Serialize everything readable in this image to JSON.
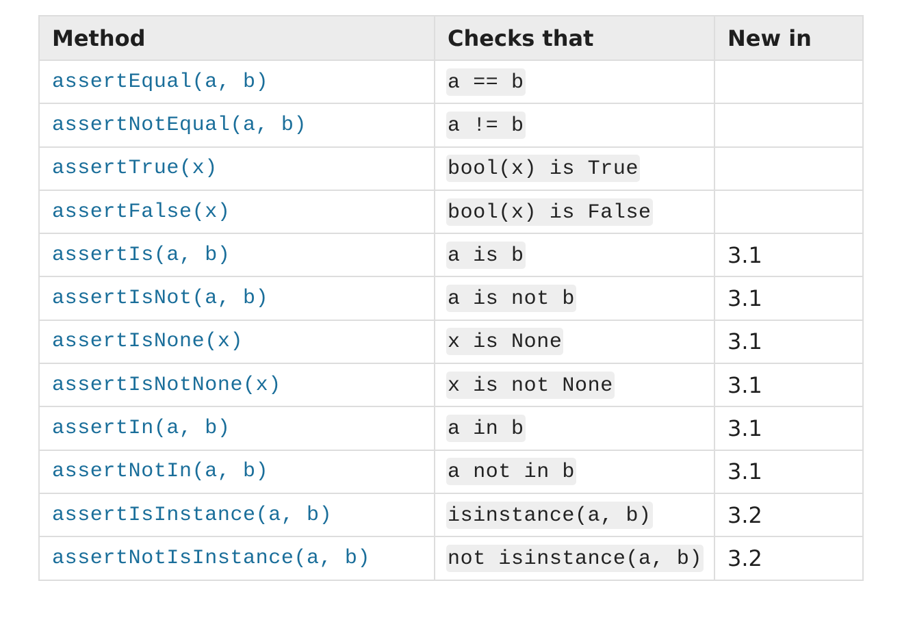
{
  "headers": {
    "method": "Method",
    "checks": "Checks that",
    "new_in": "New in"
  },
  "rows": [
    {
      "method": "assertEqual(a, b)",
      "checks": "a == b",
      "new_in": ""
    },
    {
      "method": "assertNotEqual(a, b)",
      "checks": "a != b",
      "new_in": ""
    },
    {
      "method": "assertTrue(x)",
      "checks": "bool(x) is True",
      "new_in": ""
    },
    {
      "method": "assertFalse(x)",
      "checks": "bool(x) is False",
      "new_in": ""
    },
    {
      "method": "assertIs(a, b)",
      "checks": "a is b",
      "new_in": "3.1"
    },
    {
      "method": "assertIsNot(a, b)",
      "checks": "a is not b",
      "new_in": "3.1"
    },
    {
      "method": "assertIsNone(x)",
      "checks": "x is None",
      "new_in": "3.1"
    },
    {
      "method": "assertIsNotNone(x)",
      "checks": "x is not None",
      "new_in": "3.1"
    },
    {
      "method": "assertIn(a, b)",
      "checks": "a in b",
      "new_in": "3.1"
    },
    {
      "method": "assertNotIn(a, b)",
      "checks": "a not in b",
      "new_in": "3.1"
    },
    {
      "method": "assertIsInstance(a, b)",
      "checks": "isinstance(a, b)",
      "new_in": "3.2"
    },
    {
      "method": "assertNotIsInstance(a, b)",
      "checks": "not isinstance(a, b)",
      "new_in": "3.2"
    }
  ],
  "colors": {
    "link": "#1a6e9a",
    "header_bg": "#ececec",
    "code_bg": "#eeeeee",
    "border": "#dddddd"
  }
}
